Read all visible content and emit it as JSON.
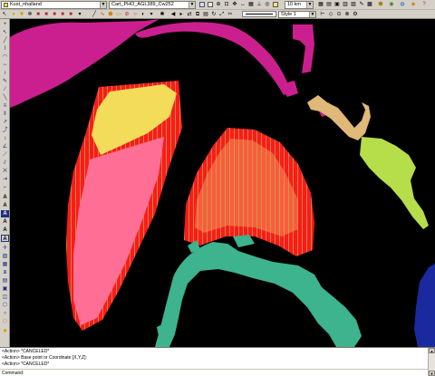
{
  "toolbar": {
    "layer_combo": {
      "value": "Kust_nhalland",
      "swatch_color": "#ffff00"
    },
    "profile_combo": {
      "value": "Cart_PHO_AGL389_Cw252"
    },
    "scale_combo": {
      "value": "10 km"
    },
    "linestyle_combo": {
      "value": "Style 1"
    }
  },
  "map": {
    "background_color": "#000000",
    "feature_colors": {
      "magenta": "#cc1f8f",
      "red": "#ff1a1a",
      "salmon": "#ff5a3c",
      "pink": "#ff6f95",
      "yellow": "#f2dc5a",
      "teal": "#3db38e",
      "tan": "#e0b878",
      "lime": "#b6dd4a",
      "navy": "#1a2a9e",
      "hatch": "#8fd05a"
    }
  },
  "command_window": {
    "lines": [
      "<Action> *CANCELED*",
      "<Action> Base point or Coordinate [X,Y,Z]:",
      "<Action> *CANCELED*"
    ],
    "prompt": "Command:"
  }
}
